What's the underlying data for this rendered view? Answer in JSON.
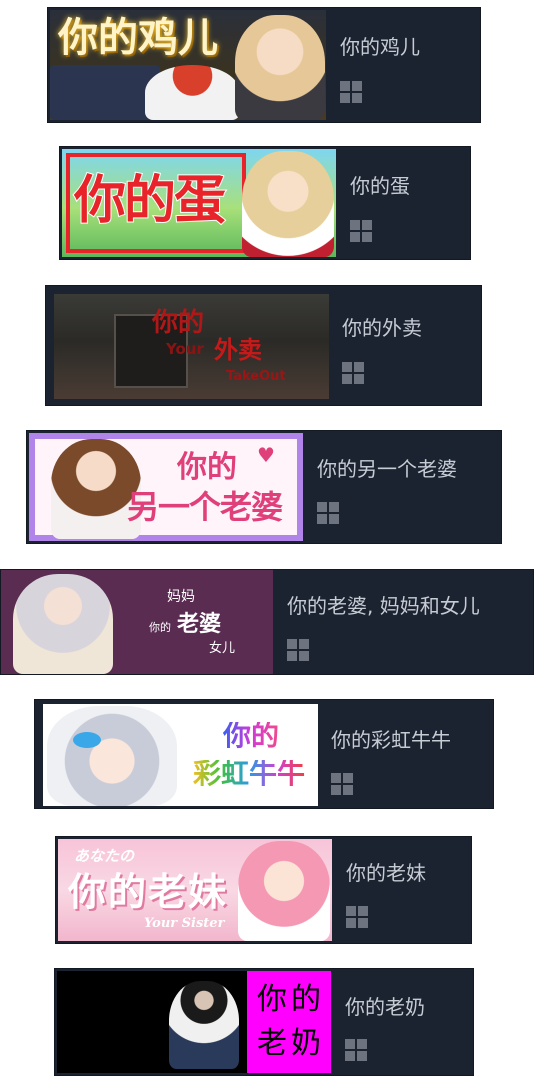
{
  "games": [
    {
      "title": "你的鸡儿",
      "capsule_text": "你的鸡儿",
      "platform_icon": "windows-icon"
    },
    {
      "title": "你的蛋",
      "capsule_text": "你的蛋",
      "platform_icon": "windows-icon"
    },
    {
      "title": "你的外卖",
      "capsule_text": {
        "line1": "你的",
        "small": "Your",
        "big": "外卖",
        "sub": "TakeOut"
      },
      "platform_icon": "windows-icon"
    },
    {
      "title": "你的另一个老婆",
      "capsule_text": {
        "line1": "你的",
        "line2": "另一个老婆"
      },
      "platform_icon": "windows-icon"
    },
    {
      "title": "你的老婆, 妈妈和女儿",
      "capsule_text": {
        "top": "妈妈",
        "left": "你的",
        "mid": "老婆",
        "bottom": "女儿"
      },
      "platform_icon": "windows-icon"
    },
    {
      "title": "你的彩虹牛牛",
      "capsule_text": {
        "line1": "你的",
        "line2": "彩虹牛牛"
      },
      "platform_icon": "windows-icon"
    },
    {
      "title": "你的老妹",
      "capsule_text": {
        "top": "あなたの",
        "main": "你的老妹",
        "sub": "Your Sister"
      },
      "platform_icon": "windows-icon"
    },
    {
      "title": "你的老奶",
      "capsule_text": {
        "line1": "你的",
        "line2": "老奶"
      },
      "platform_icon": "windows-icon"
    }
  ],
  "colors": {
    "card_bg": "#1b2230",
    "title_text": "#c6ccd4",
    "icon_gray": "#6d7480",
    "egg_red": "#e8242a",
    "wife_pink": "#e0407a",
    "mom_purple": "#5a2c52",
    "grandma_magenta": "#ff00ff"
  }
}
